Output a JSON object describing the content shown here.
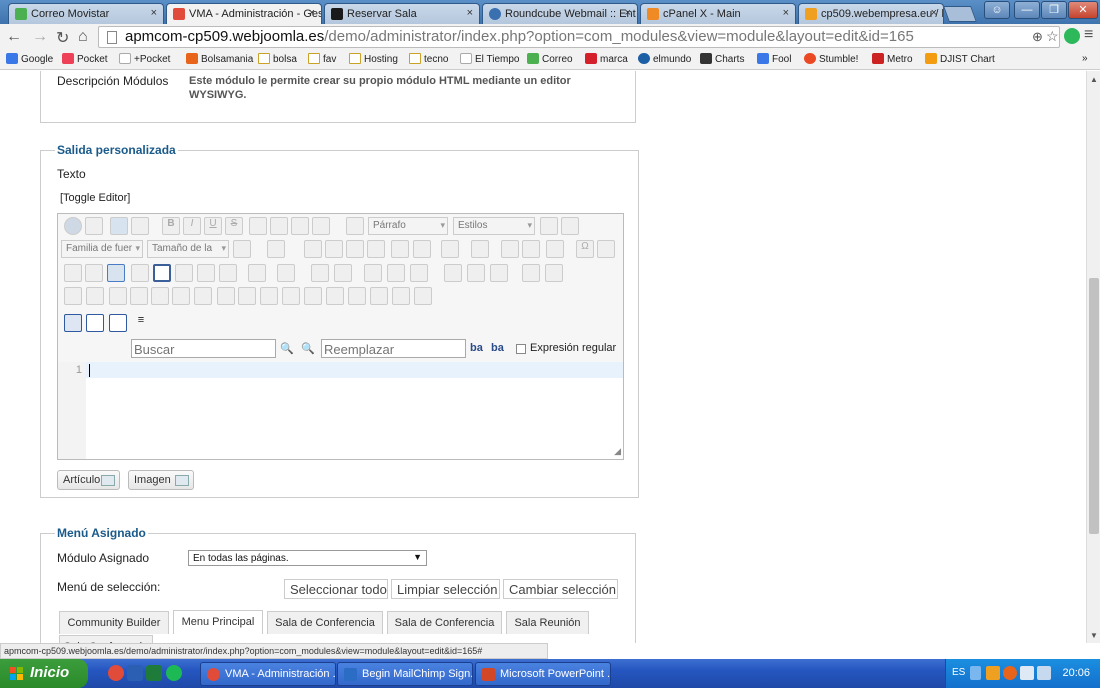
{
  "browser": {
    "tabs": [
      {
        "title": "Correo Movistar",
        "favicon_color": "#4caf50"
      },
      {
        "title": "VMA - Administración - Ges",
        "favicon_color": "#e04b3a"
      },
      {
        "title": "Reservar Sala",
        "favicon_color": "#1a1a1a"
      },
      {
        "title": "Roundcube Webmail :: Ent",
        "favicon_color": "#3a6fb0"
      },
      {
        "title": "cPanel X - Main",
        "favicon_color": "#f08a24"
      },
      {
        "title": "cp509.webempresa.eu / lo",
        "favicon_color": "#f0a020"
      }
    ],
    "tab_close": "×",
    "window_buttons": [
      "☺",
      "—",
      "❐",
      "✕"
    ],
    "url_host": "apmcom-cp509.webjoomla.es",
    "url_path": "/demo/administrator/index.php?option=com_modules&view=module&layout=edit&id=165",
    "bookmarks": [
      {
        "label": "Google",
        "icon_color": "#3b78e7"
      },
      {
        "label": "Pocket",
        "icon_color": "#ee4056"
      },
      {
        "label": "+Pocket",
        "icon_color": "#ffffff"
      },
      {
        "label": "Bolsamania",
        "icon_color": "#e8641b"
      },
      {
        "label": "bolsa",
        "icon_color": "folder"
      },
      {
        "label": "fav",
        "icon_color": "folder"
      },
      {
        "label": "Hosting",
        "icon_color": "folder"
      },
      {
        "label": "tecno",
        "icon_color": "folder"
      },
      {
        "label": "El Tiempo",
        "icon_color": "#ffffff"
      },
      {
        "label": "Correo",
        "icon_color": "#4caf50"
      },
      {
        "label": "marca",
        "icon_color": "#d4202a"
      },
      {
        "label": "elmundo",
        "icon_color": "#1d5fa5"
      },
      {
        "label": "Charts",
        "icon_color": "#333333"
      },
      {
        "label": "Fool",
        "icon_color": "#3b78e7"
      },
      {
        "label": "Stumble!",
        "icon_color": "#eb4924"
      },
      {
        "label": "Metro",
        "icon_color": "#cc2222"
      },
      {
        "label": "DJIST Chart",
        "icon_color": "#f39c12"
      }
    ],
    "bookmarks_more": "»",
    "status_url": "apmcom-cp509.webjoomla.es/demo/administrator/index.php?option=com_modules&view=module&layout=edit&id=165#"
  },
  "module_info": {
    "label": "Descripción Módulos",
    "text_line1": "Este módulo le permite crear su propio módulo HTML mediante un editor",
    "text_line2": "WYSIWYG."
  },
  "custom_output": {
    "legend": "Salida personalizada",
    "text_label": "Texto",
    "toggle_editor": "[Toggle Editor]",
    "format_select": "Párrafo",
    "styles_select": "Estilos",
    "font_family_select": "Familia de fuer",
    "font_size_select": "Tamaño de la",
    "search_placeholder": "Buscar",
    "replace_placeholder": "Reemplazar",
    "regex_label": "Expresión regular",
    "line_number": "1",
    "article_button": "Artículo",
    "image_button": "Imagen"
  },
  "menu_assignment": {
    "legend": "Menú Asignado",
    "module_assigned_label": "Módulo Asignado",
    "module_assigned_value": "En todas las páginas.",
    "menu_selection_label": "Menú de selección:",
    "select_all": "Seleccionar todo",
    "clear_selection": "Limpiar selección",
    "change_selection": "Cambiar selección",
    "menu_tabs": [
      "Community Builder",
      "Menu Principal",
      "Sala de Conferencia",
      "Sala de Conferencia",
      "Sala Reunión"
    ],
    "active_tab_index": 1,
    "partial_tab": "Sala Conferencia"
  },
  "taskbar": {
    "start_label": "Inicio",
    "tasks": [
      {
        "label": "VMA - Administración ...",
        "icon_color": "#e04b3a"
      },
      {
        "label": "Begin MailChimp Sign...",
        "icon_color": "#2b6cc4"
      },
      {
        "label": "Microsoft PowerPoint ...",
        "icon_color": "#d24726"
      }
    ],
    "language": "ES",
    "clock": "20:06"
  }
}
